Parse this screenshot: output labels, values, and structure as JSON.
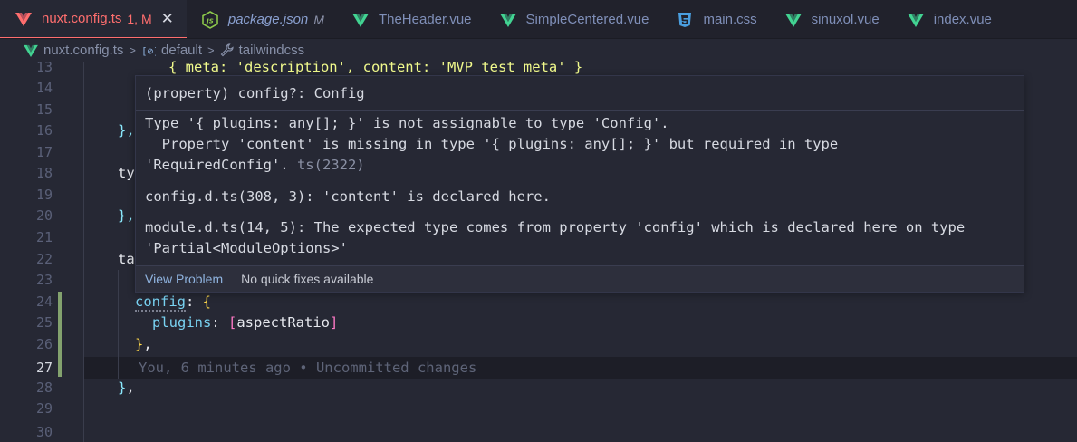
{
  "tabs": [
    {
      "name": "nuxt.config.ts",
      "mod": "1, M",
      "icon": "vue-icon",
      "active": true
    },
    {
      "name": "package.json",
      "mod": "M",
      "icon": "node-js-icon",
      "active": false
    },
    {
      "name": "TheHeader.vue",
      "mod": "",
      "icon": "vue-icon",
      "active": false
    },
    {
      "name": "SimpleCentered.vue",
      "mod": "",
      "icon": "vue-icon",
      "active": false
    },
    {
      "name": "main.css",
      "mod": "",
      "icon": "css-icon",
      "active": false
    },
    {
      "name": "sinuxol.vue",
      "mod": "",
      "icon": "vue-icon",
      "active": false
    },
    {
      "name": "index.vue",
      "mod": "",
      "icon": "vue-icon",
      "active": false
    }
  ],
  "close_glyph": "✕",
  "breadcrumb": {
    "file": "nuxt.config.ts",
    "default_label": "default",
    "module_label": "tailwindcss"
  },
  "gutter": {
    "lines": [
      "13",
      "14",
      "15",
      "16",
      "17",
      "18",
      "19",
      "20",
      "21",
      "22",
      "23",
      "24",
      "25",
      "26",
      "27",
      "28",
      "29",
      "30"
    ],
    "current": "27"
  },
  "code": {
    "l13": "{ meta: 'description', content: 'MVP test meta' }",
    "l16_a": "},",
    "l18_a": "ty",
    "l20_a": "},",
    "l22_a": "ta",
    "l24_key": "config",
    "l24_colon": ": ",
    "l24_brace": "{",
    "l25_key": "plugins",
    "l25_colon": ": ",
    "l25_open": "[",
    "l25_val": "aspectRatio",
    "l25_close": "]",
    "l26_brace": "}",
    "l26_comma": ",",
    "l27_blame": "You, 6 minutes ago • Uncommitted changes",
    "l28_brace": "}",
    "l28_comma": ","
  },
  "hover": {
    "signature": "(property) config?: Config",
    "line1": "Type '{ plugins: any[]; }' is not assignable to type 'Config'.",
    "line2": "  Property 'content' is missing in type '{ plugins: any[]; }' but required in type",
    "line3": "'RequiredConfig'.",
    "line3_code": " ts(2322)",
    "line4": "config.d.ts(308, 3): 'content' is declared here.",
    "line5": "module.d.ts(14, 5): The expected type comes from property 'config' which is declared here on type",
    "line6": "'Partial<ModuleOptions>'",
    "view_problem": "View Problem",
    "no_fixes": "No quick fixes available"
  },
  "colors": {
    "active_tab": "#ff6e6e",
    "vue": "#42d392",
    "css": "#4a9fe0",
    "node": "#8cc84b",
    "git_modified": "#83a26e"
  }
}
